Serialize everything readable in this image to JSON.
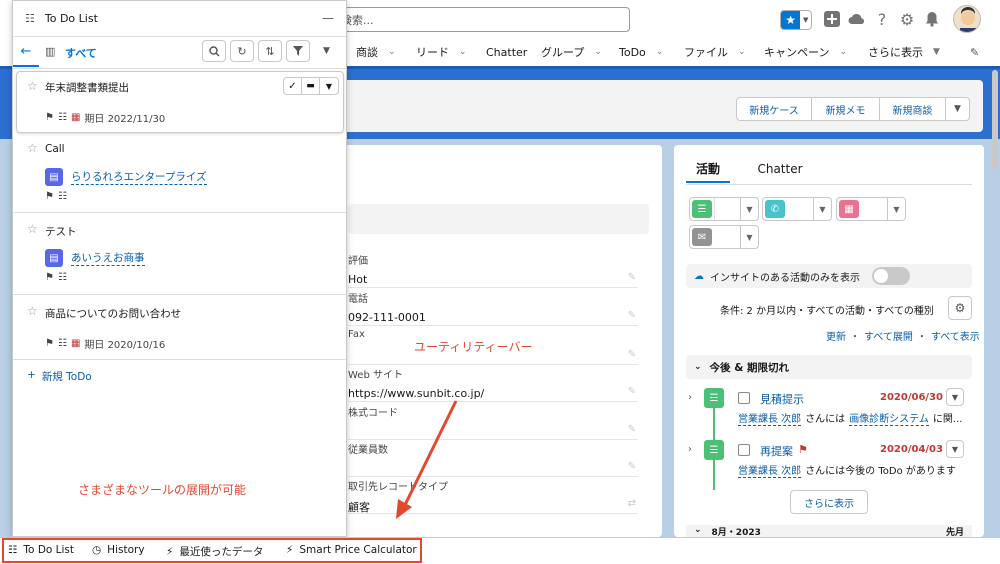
{
  "topbar": {
    "search_placeholder": "検索...",
    "favorites_icon": "star-icon",
    "icons": [
      "add-icon",
      "cloud-icon",
      "help-icon",
      "gear-icon",
      "bell-icon"
    ]
  },
  "nav": {
    "items": [
      {
        "label": "商談",
        "chev": true
      },
      {
        "label": "リード",
        "chev": true
      },
      {
        "label": "Chatter",
        "chev": false
      },
      {
        "label": "グループ",
        "chev": true
      },
      {
        "label": "ToDo",
        "chev": true
      },
      {
        "label": "ファイル",
        "chev": true
      },
      {
        "label": "キャンペーン",
        "chev": true
      },
      {
        "label": "さらに表示",
        "chev": true
      }
    ]
  },
  "header_buttons": [
    "新規ケース",
    "新規メモ",
    "新規商談"
  ],
  "record": {
    "fields": [
      {
        "label": "評価",
        "value": "Hot",
        "link": false
      },
      {
        "label": "電話",
        "value": "092-111-0001",
        "link": true
      },
      {
        "label": "Fax",
        "value": "",
        "link": false
      },
      {
        "label": "Web サイト",
        "value": "https://www.sunbit.co.jp/",
        "link": true
      },
      {
        "label": "株式コード",
        "value": "",
        "link": false
      },
      {
        "label": "従業員数",
        "value": "",
        "link": false
      },
      {
        "label": "取引先レコードタイプ",
        "value": "顧客",
        "link": false
      }
    ]
  },
  "activity": {
    "tabs": [
      "活動",
      "Chatter"
    ],
    "insight_label": "インサイトのある活動のみを表示",
    "filter_text": "条件: 2 か月以内・すべての活動・すべての種別",
    "links": [
      "更新",
      "すべて展開",
      "すべて表示"
    ],
    "section_title": "今後 & 期限切れ",
    "items": [
      {
        "title": "見積提示",
        "date": "2020/06/30",
        "who": "営業課長 次郎",
        "mid": "さんには",
        "what": "画像診断システム",
        "tail": "に関..."
      },
      {
        "title": "再提案",
        "date": "2020/04/03",
        "who": "営業課長 次郎",
        "mid": "さんには今後の ToDo があります",
        "what": "",
        "tail": ""
      }
    ],
    "more_button": "さらに表示",
    "next_section": "8月・2023",
    "next_section_right": "先月"
  },
  "panel": {
    "title": "To Do List",
    "view": "すべて",
    "tasks": [
      {
        "title": "年末調整書類提出",
        "due": "期日 2022/11/30",
        "account": ""
      },
      {
        "title": "Call",
        "due": "",
        "account": "らりるれろエンタープライズ"
      },
      {
        "title": "テスト",
        "due": "",
        "account": "あいうえお商事"
      },
      {
        "title": "商品についてのお問い合わせ",
        "due": "期日 2020/10/16",
        "account": ""
      }
    ],
    "new_label": "新規 ToDo"
  },
  "utility_bar": {
    "items": [
      {
        "label": "To Do List",
        "icon": "checklist-icon"
      },
      {
        "label": "History",
        "icon": "clock-icon"
      },
      {
        "label": "最近使ったデータ",
        "icon": "bolt-icon"
      },
      {
        "label": "Smart Price Calculator",
        "icon": "bolt-icon"
      }
    ]
  },
  "annotations": {
    "utility_label": "ユーティリティーバー",
    "tools_label": "さまざまなツールの展開が可能"
  },
  "colors": {
    "brand": "#0176d3",
    "nav_border": "#1b5cb5",
    "header_bg": "#2d6fcf",
    "annotation": "#e4482f",
    "task_green": "#4bc076",
    "overdue_red": "#c23934",
    "account_icon": "#5867e8"
  }
}
